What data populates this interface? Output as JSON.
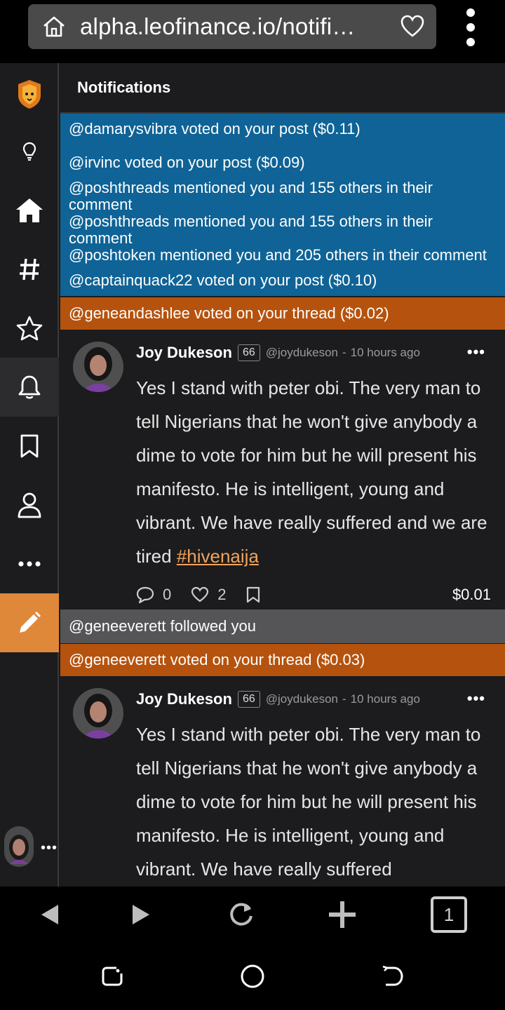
{
  "browser": {
    "url": "alpha.leofinance.io/notifi…",
    "tab_count": "1"
  },
  "page": {
    "title": "Notifications"
  },
  "notifications_top": [
    "@damarysvibra voted on your post ($0.11)",
    "@irvinc voted on your post ($0.09)",
    "@poshthreads mentioned you and 155 others in their comment",
    "@poshthreads mentioned you and 155 others in their comment",
    "@poshtoken mentioned you and 205 others in their comment",
    "@captainquack22 voted on your post ($0.10)"
  ],
  "notif_orange_1": "@geneandashlee voted on your thread ($0.02)",
  "post1": {
    "author": "Joy Dukeson",
    "rep": "66",
    "handle": "@joydukeson",
    "separator": "-",
    "time": "10 hours ago",
    "body": "Yes I stand with peter obi. The very man to tell Nigerians that he won't give anybody a dime to vote for him but he will present his manifesto. He is intelligent, young and vibrant. We have really suffered and we are tired ",
    "tag": "#hivenaija",
    "comments": "0",
    "likes": "2",
    "payout": "$0.01"
  },
  "notif_gray_1": "@geneeverett followed you",
  "notif_orange_2": "@geneeverett voted on your thread ($0.03)",
  "post2": {
    "author": "Joy Dukeson",
    "rep": "66",
    "handle": "@joydukeson",
    "separator": "-",
    "time": "10 hours ago",
    "body": "Yes I stand with peter obi. The very man to tell Nigerians that he won't give anybody a dime to vote for him but he will present his manifesto. He is intelligent, young and vibrant. We have really suffered"
  },
  "colors": {
    "accent": "#e0883a",
    "notif_blue": "#0f6396",
    "notif_orange": "#b5530e",
    "notif_gray": "#555557"
  },
  "icons": [
    "home-icon",
    "heart-icon",
    "kebab-menu-icon",
    "lion-logo",
    "lightbulb-icon",
    "house-icon",
    "hashtag-icon",
    "star-icon",
    "bell-icon",
    "bookmark-icon",
    "user-icon",
    "more-icon",
    "pencil-icon",
    "comment-icon",
    "back-icon",
    "forward-icon",
    "reload-icon",
    "plus-icon"
  ]
}
